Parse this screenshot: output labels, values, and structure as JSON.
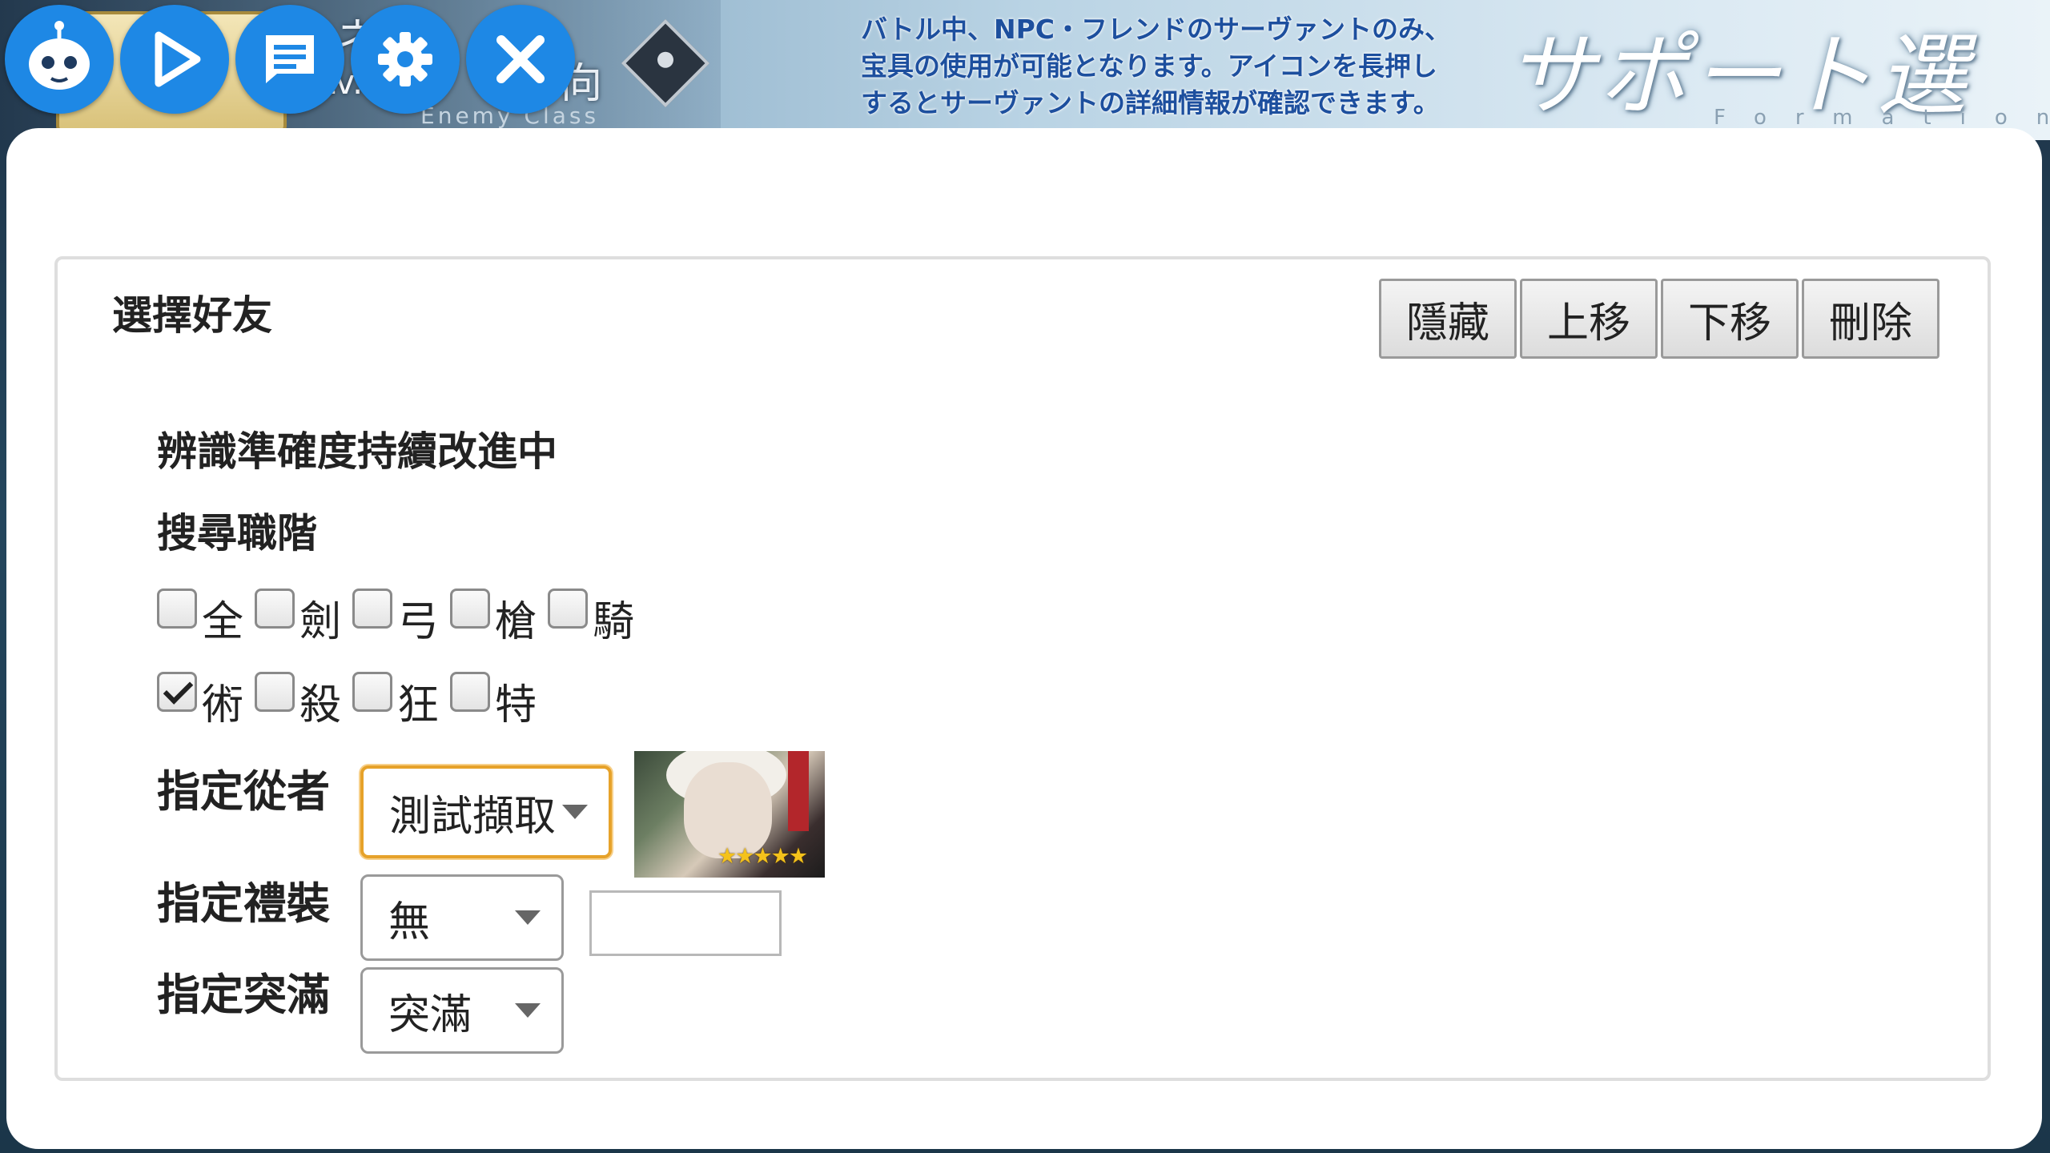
{
  "banner": {
    "quest_text": "ネの",
    "quest_sub": "向",
    "lv_text": "Lv.",
    "enemy_class_label": "Enemy Class",
    "notice_lines": [
      "バトル中、NPC・フレンドのサーヴァントのみ、",
      "宝具の使用が可能となります。アイコンを長押し",
      "するとサーヴァントの詳細情報が確認できます。"
    ],
    "title": "サポート選択",
    "title_sub": "Formation"
  },
  "toolbar": {
    "buttons": [
      {
        "icon": "robot-icon"
      },
      {
        "icon": "play-icon"
      },
      {
        "icon": "message-icon"
      },
      {
        "icon": "gear-icon"
      },
      {
        "icon": "close-icon"
      }
    ]
  },
  "panel": {
    "section_title": "選擇好友",
    "actions": {
      "hide": "隱藏",
      "move_up": "上移",
      "move_down": "下移",
      "delete": "刪除"
    },
    "note": "辨識準確度持續改進中",
    "search_class_label": "搜尋職階",
    "classes": [
      {
        "label": "全",
        "checked": false
      },
      {
        "label": "劍",
        "checked": false
      },
      {
        "label": "弓",
        "checked": false
      },
      {
        "label": "槍",
        "checked": false
      },
      {
        "label": "騎",
        "checked": false
      },
      {
        "label": "術",
        "checked": true
      },
      {
        "label": "殺",
        "checked": false
      },
      {
        "label": "狂",
        "checked": false
      },
      {
        "label": "特",
        "checked": false
      }
    ],
    "servant": {
      "label": "指定從者",
      "selected": "測試擷取",
      "rarity_stars": "★★★★★"
    },
    "craft_essence": {
      "label": "指定禮裝",
      "selected": "無",
      "input_value": ""
    },
    "limit_break": {
      "label": "指定突滿",
      "selected": "突滿"
    }
  },
  "colors": {
    "toolbar_button": "#1e88e5",
    "focus_border": "#e6a22a"
  }
}
